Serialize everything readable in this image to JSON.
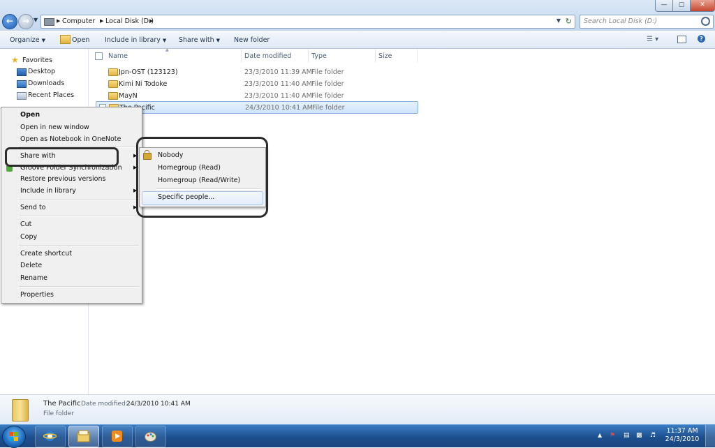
{
  "address": {
    "crumbs": [
      "Computer",
      "Local Disk (D:)"
    ],
    "search_placeholder": "Search Local Disk (D:)"
  },
  "toolbar": {
    "organize": "Organize",
    "open": "Open",
    "include_in_library": "Include in library",
    "share_with": "Share with",
    "new_folder": "New folder"
  },
  "navpane": {
    "favorites": "Favorites",
    "items": [
      "Desktop",
      "Downloads",
      "Recent Places"
    ]
  },
  "columns": {
    "name": "Name",
    "date_modified": "Date modified",
    "type": "Type",
    "size": "Size"
  },
  "files": [
    {
      "name": "Jpn-OST (123123)",
      "date": "23/3/2010 11:39 AM",
      "type": "File folder"
    },
    {
      "name": "Kimi Ni Todoke",
      "date": "23/3/2010 11:40 AM",
      "type": "File folder"
    },
    {
      "name": "MayN",
      "date": "23/3/2010 11:40 AM",
      "type": "File folder"
    },
    {
      "name": "The Pacific",
      "date": "24/3/2010 10:41 AM",
      "type": "File folder",
      "selected": true
    }
  ],
  "context_menu": {
    "open": "Open",
    "open_new_window": "Open in new window",
    "open_onenote": "Open as Notebook in OneNote",
    "share_with": "Share with",
    "groove": "Groove Folder Synchronization",
    "restore": "Restore previous versions",
    "include_library": "Include in library",
    "send_to": "Send to",
    "cut": "Cut",
    "copy": "Copy",
    "create_shortcut": "Create shortcut",
    "delete": "Delete",
    "rename": "Rename",
    "properties": "Properties"
  },
  "share_submenu": {
    "nobody": "Nobody",
    "homegroup_read": "Homegroup (Read)",
    "homegroup_readwrite": "Homegroup (Read/Write)",
    "specific_people": "Specific people..."
  },
  "details": {
    "name": "The Pacific",
    "date_label": "Date modified:",
    "date_value": "24/3/2010 10:41 AM",
    "type": "File folder"
  },
  "taskbar": {
    "time": "11:37 AM",
    "date": "24/3/2010",
    "pinned": [
      "internet-explorer",
      "windows-explorer",
      "media-player",
      "paint"
    ]
  },
  "colors": {
    "accent": "#1d5fb8",
    "selection": "#cfe4fb",
    "annotation": "#2c2c2c"
  }
}
